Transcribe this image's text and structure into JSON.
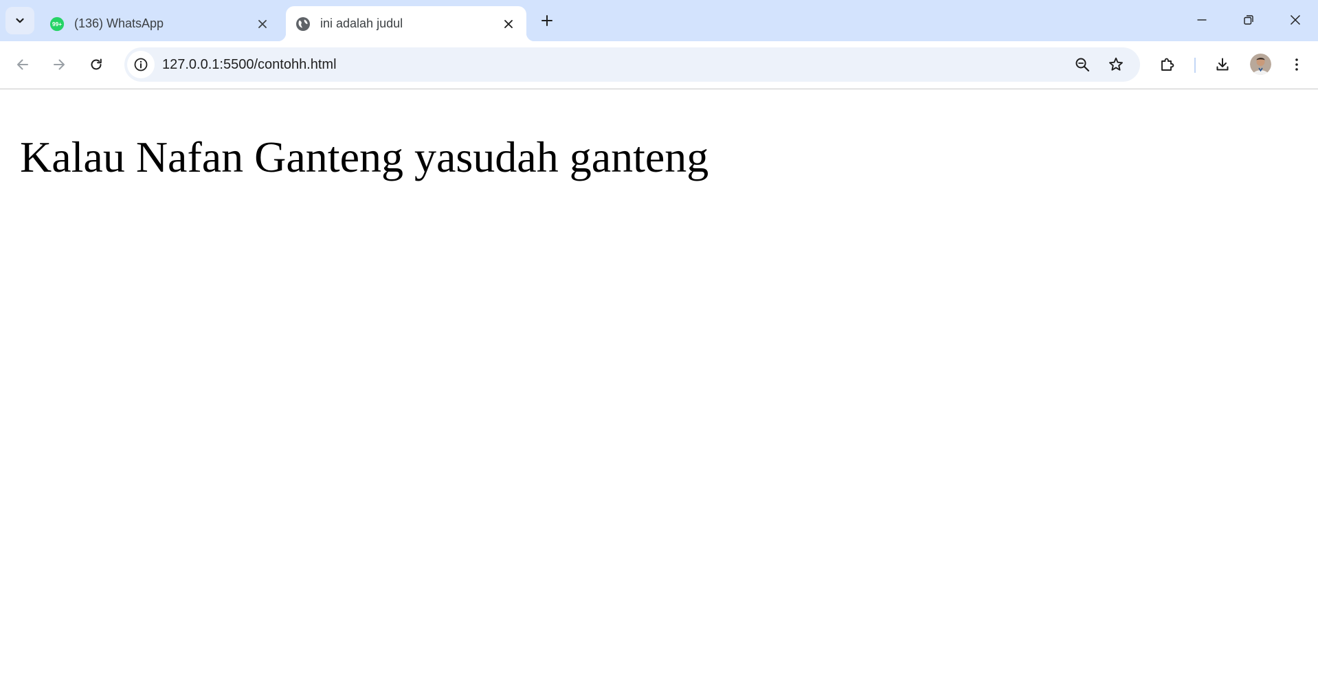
{
  "tabs": [
    {
      "title": "(136) WhatsApp",
      "favicon": "whatsapp-icon",
      "badge": "99+",
      "active": false
    },
    {
      "title": "ini adalah judul",
      "favicon": "globe-icon",
      "active": true
    }
  ],
  "toolbar": {
    "url": "127.0.0.1:5500/contohh.html"
  },
  "page": {
    "heading": "Kalau Nafan Ganteng yasudah ganteng"
  },
  "colors": {
    "tabstrip_bg": "#d3e3fd",
    "omnibox_bg": "#edf2fa",
    "whatsapp_green": "#25d366"
  }
}
